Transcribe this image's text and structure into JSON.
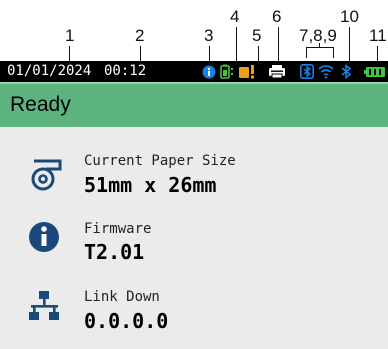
{
  "callouts": [
    "1",
    "2",
    "3",
    "4",
    "5",
    "6",
    "7,8,9",
    "10",
    "11"
  ],
  "status_bar": {
    "date": "01/01/2024",
    "time": "00:12",
    "icons": [
      "info-icon",
      "battery-status-icon",
      "warning-icon",
      "printer-icon",
      "bluetooth-mode-icon",
      "wifi-icon",
      "bluetooth-icon",
      "battery-icon"
    ]
  },
  "status": {
    "label": "Ready"
  },
  "colors": {
    "status_bar_bg": "#000000",
    "ready_bg": "#5db37e",
    "panel_bg": "#ebebeb",
    "accent_blue": "#1a7fe0",
    "battery_green": "#45c23d",
    "warn_orange": "#e8a11a",
    "icon_navy": "#1b4a7a"
  },
  "info": {
    "paper": {
      "label": "Current Paper Size",
      "value": "51mm x 26mm"
    },
    "firmware": {
      "label": "Firmware",
      "value": "T2.01"
    },
    "network": {
      "label": "Link Down",
      "value": "0.0.0.0"
    }
  }
}
